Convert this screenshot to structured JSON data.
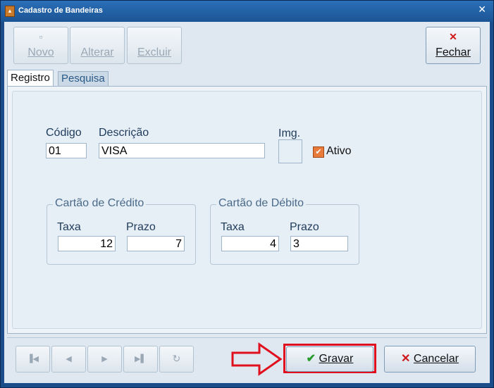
{
  "window": {
    "title": "Cadastro de Bandeiras",
    "close_glyph": "✕"
  },
  "toolbar": {
    "novo_label": "Novo",
    "alterar_label": "Alterar",
    "excluir_label": "Excluir",
    "fechar_label": "Fechar"
  },
  "tabs": [
    {
      "label": "Registro"
    },
    {
      "label": "Pesquisa"
    }
  ],
  "form": {
    "codigo_label": "Código",
    "codigo_value": "01",
    "descricao_label": "Descrição",
    "descricao_value": "VISA",
    "img_label": "Img.",
    "ativo_label": "Ativo",
    "ativo_checked": true
  },
  "credito": {
    "title": "Cartão de Crédito",
    "taxa_label": "Taxa",
    "taxa_value": "12",
    "prazo_label": "Prazo",
    "prazo_value": "7"
  },
  "debito": {
    "title": "Cartão de Débito",
    "taxa_label": "Taxa",
    "taxa_value": "4",
    "prazo_label": "Prazo",
    "prazo_value": "3"
  },
  "actions": {
    "gravar_label": "Gravar",
    "cancelar_label": "Cancelar"
  },
  "colors": {
    "highlight": "#e0101e",
    "accent": "#1a4d8a"
  }
}
